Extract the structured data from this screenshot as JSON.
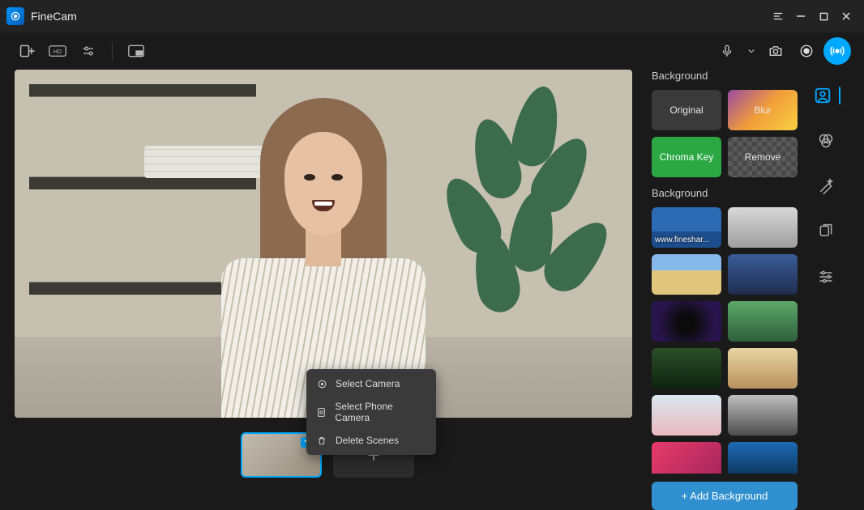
{
  "app": {
    "name": "FineCam"
  },
  "context_menu": {
    "select_camera": "Select Camera",
    "select_phone": "Select Phone Camera",
    "delete_scenes": "Delete Scenes"
  },
  "panel": {
    "title_background": "Background",
    "original": "Original",
    "blur": "Blur",
    "chroma": "Chroma Key",
    "remove": "Remove",
    "title_bg_list": "Background",
    "bg0_label": "www.fineshar...",
    "add_bg": "+ Add Background"
  }
}
